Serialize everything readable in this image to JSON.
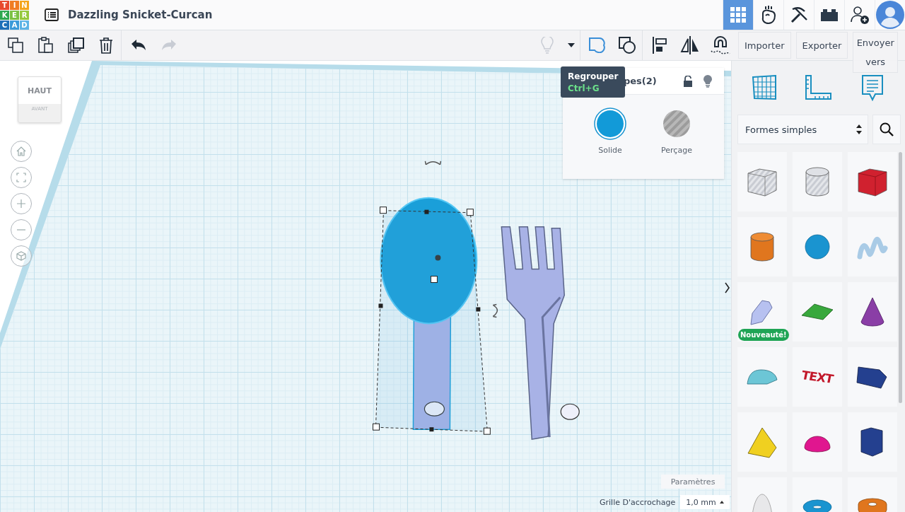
{
  "app": {
    "logo": [
      {
        "letter": "T",
        "color": "#e8492e"
      },
      {
        "letter": "I",
        "color": "#f07c22"
      },
      {
        "letter": "N",
        "color": "#f4a51c"
      },
      {
        "letter": "K",
        "color": "#2ea84f"
      },
      {
        "letter": "E",
        "color": "#7bc143"
      },
      {
        "letter": "R",
        "color": "#95c83d"
      },
      {
        "letter": "C",
        "color": "#1d6fb8"
      },
      {
        "letter": "A",
        "color": "#3b9ad9"
      },
      {
        "letter": "D",
        "color": "#5db4e6"
      }
    ],
    "title": "Dazzling Snicket-Curcan"
  },
  "top_nav": [
    {
      "kind": "grid",
      "selected": true
    },
    {
      "kind": "blocks",
      "selected": false
    },
    {
      "kind": "pickaxe",
      "selected": false
    },
    {
      "kind": "brick",
      "selected": false
    },
    {
      "kind": "add-user",
      "selected": false
    },
    {
      "kind": "avatar",
      "selected": false
    }
  ],
  "toolbar": {
    "edit_tools": [
      {
        "kind": "copy",
        "disabled": false
      },
      {
        "kind": "paste",
        "disabled": false
      },
      {
        "kind": "duplicate",
        "disabled": false
      },
      {
        "kind": "delete",
        "disabled": false
      },
      {
        "kind": "undo",
        "disabled": false
      },
      {
        "kind": "redo",
        "disabled": true
      }
    ],
    "shape_tools": [
      {
        "kind": "bulb",
        "disabled": true,
        "highlighted": false
      },
      {
        "kind": "caret"
      },
      {
        "kind": "group",
        "disabled": false,
        "highlighted": true
      },
      {
        "kind": "ungroup",
        "disabled": false,
        "highlighted": false
      },
      {
        "kind": "align",
        "disabled": false,
        "highlighted": false
      },
      {
        "kind": "mirror",
        "disabled": false,
        "highlighted": false
      },
      {
        "kind": "magnet",
        "disabled": false,
        "highlighted": false
      }
    ],
    "actions": [
      "Importer",
      "Exporter",
      "Envoyer vers"
    ]
  },
  "tooltip": {
    "title": "Regrouper",
    "shortcut": "Ctrl+G"
  },
  "view_cube": {
    "top": "HAUT",
    "front": "AVANT"
  },
  "view_controls": [
    {
      "kind": "home"
    },
    {
      "kind": "fit"
    },
    {
      "kind": "zoom-in"
    },
    {
      "kind": "zoom-out"
    },
    {
      "kind": "perspective"
    }
  ],
  "inspector": {
    "title": "pes(2)",
    "locked": false,
    "options": [
      {
        "kind": "solid",
        "label": "Solide",
        "selected": true
      },
      {
        "kind": "hole",
        "label": "Perçage",
        "selected": false
      }
    ]
  },
  "grid_settings": {
    "button": "Paramètres",
    "label": "Grille D'accrochage",
    "value": "1,0 mm"
  },
  "library": {
    "tabs": [
      {
        "kind": "grid"
      },
      {
        "kind": "ruler"
      },
      {
        "kind": "note"
      }
    ],
    "category": "Formes simples",
    "shapes": [
      {
        "kind": "box-hole",
        "color": "#c9ccd3"
      },
      {
        "kind": "cylinder-hole",
        "color": "#c9ccd3"
      },
      {
        "kind": "box",
        "color": "#d0212f"
      },
      {
        "kind": "cylinder",
        "color": "#e0761e"
      },
      {
        "kind": "sphere",
        "color": "#1a94d0"
      },
      {
        "kind": "scribble",
        "color": "#a9cbe6"
      },
      {
        "kind": "polyline",
        "color": "#b7c1f0",
        "badge": "Nouveauté!"
      },
      {
        "kind": "roof",
        "color": "#38a83c"
      },
      {
        "kind": "cone",
        "color": "#8a3ea6"
      },
      {
        "kind": "round-roof",
        "color": "#6cc6d6"
      },
      {
        "kind": "text",
        "color": "#c2182a",
        "label": "TEXT"
      },
      {
        "kind": "polygon",
        "color": "#24408f"
      },
      {
        "kind": "pyramid",
        "color": "#f0d020"
      },
      {
        "kind": "half-sphere",
        "color": "#e0168f"
      },
      {
        "kind": "hex-prism",
        "color": "#24408f"
      },
      {
        "kind": "paraboloid",
        "color": "#e8e8ea"
      },
      {
        "kind": "torus",
        "color": "#1a94d0"
      },
      {
        "kind": "tube",
        "color": "#e0761e"
      }
    ]
  }
}
